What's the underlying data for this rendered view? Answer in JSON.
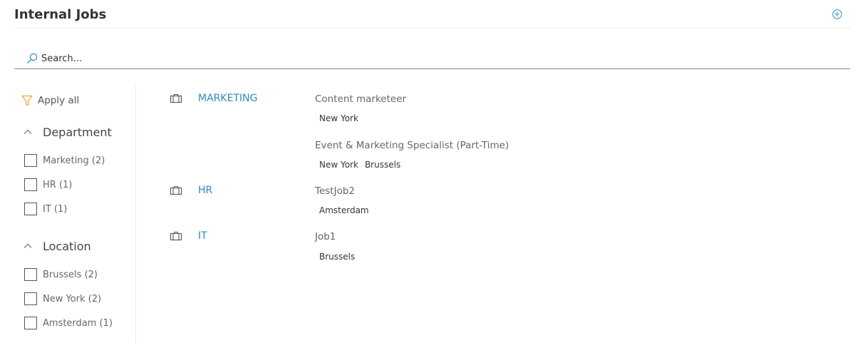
{
  "header": {
    "title": "Internal Jobs",
    "add_icon": "plus-circle-icon"
  },
  "search": {
    "placeholder": "Search...",
    "icon": "search-icon"
  },
  "filters": {
    "apply_all_label": "Apply all",
    "apply_all_icon": "filter-icon",
    "filter_icon_color": "#e8a33d",
    "groups": [
      {
        "title": "Department",
        "expanded": true,
        "options": [
          {
            "label": "Marketing (2)",
            "checked": false
          },
          {
            "label": "HR (1)",
            "checked": false
          },
          {
            "label": "IT (1)",
            "checked": false
          }
        ]
      },
      {
        "title": "Location",
        "expanded": true,
        "options": [
          {
            "label": "Brussels (2)",
            "checked": false
          },
          {
            "label": "New York (2)",
            "checked": false
          },
          {
            "label": "Amsterdam (1)",
            "checked": false
          }
        ]
      }
    ]
  },
  "departments": [
    {
      "name": "MARKETING",
      "icon": "briefcase-icon",
      "jobs": [
        {
          "title": "Content marketeer",
          "locations": [
            "New York"
          ]
        },
        {
          "title": "Event & Marketing Specialist (Part-Time)",
          "locations": [
            "New York",
            "Brussels"
          ]
        }
      ]
    },
    {
      "name": "HR",
      "icon": "briefcase-icon",
      "jobs": [
        {
          "title": "TestJob2",
          "locations": [
            "Amsterdam"
          ]
        }
      ]
    },
    {
      "name": "IT",
      "icon": "briefcase-icon",
      "jobs": [
        {
          "title": "Job1",
          "locations": [
            "Brussels"
          ]
        }
      ]
    }
  ],
  "colors": {
    "accent": "#2e8bbf",
    "filter_icon": "#e8a33d",
    "title_text": "#333333",
    "muted_text": "#666666"
  }
}
